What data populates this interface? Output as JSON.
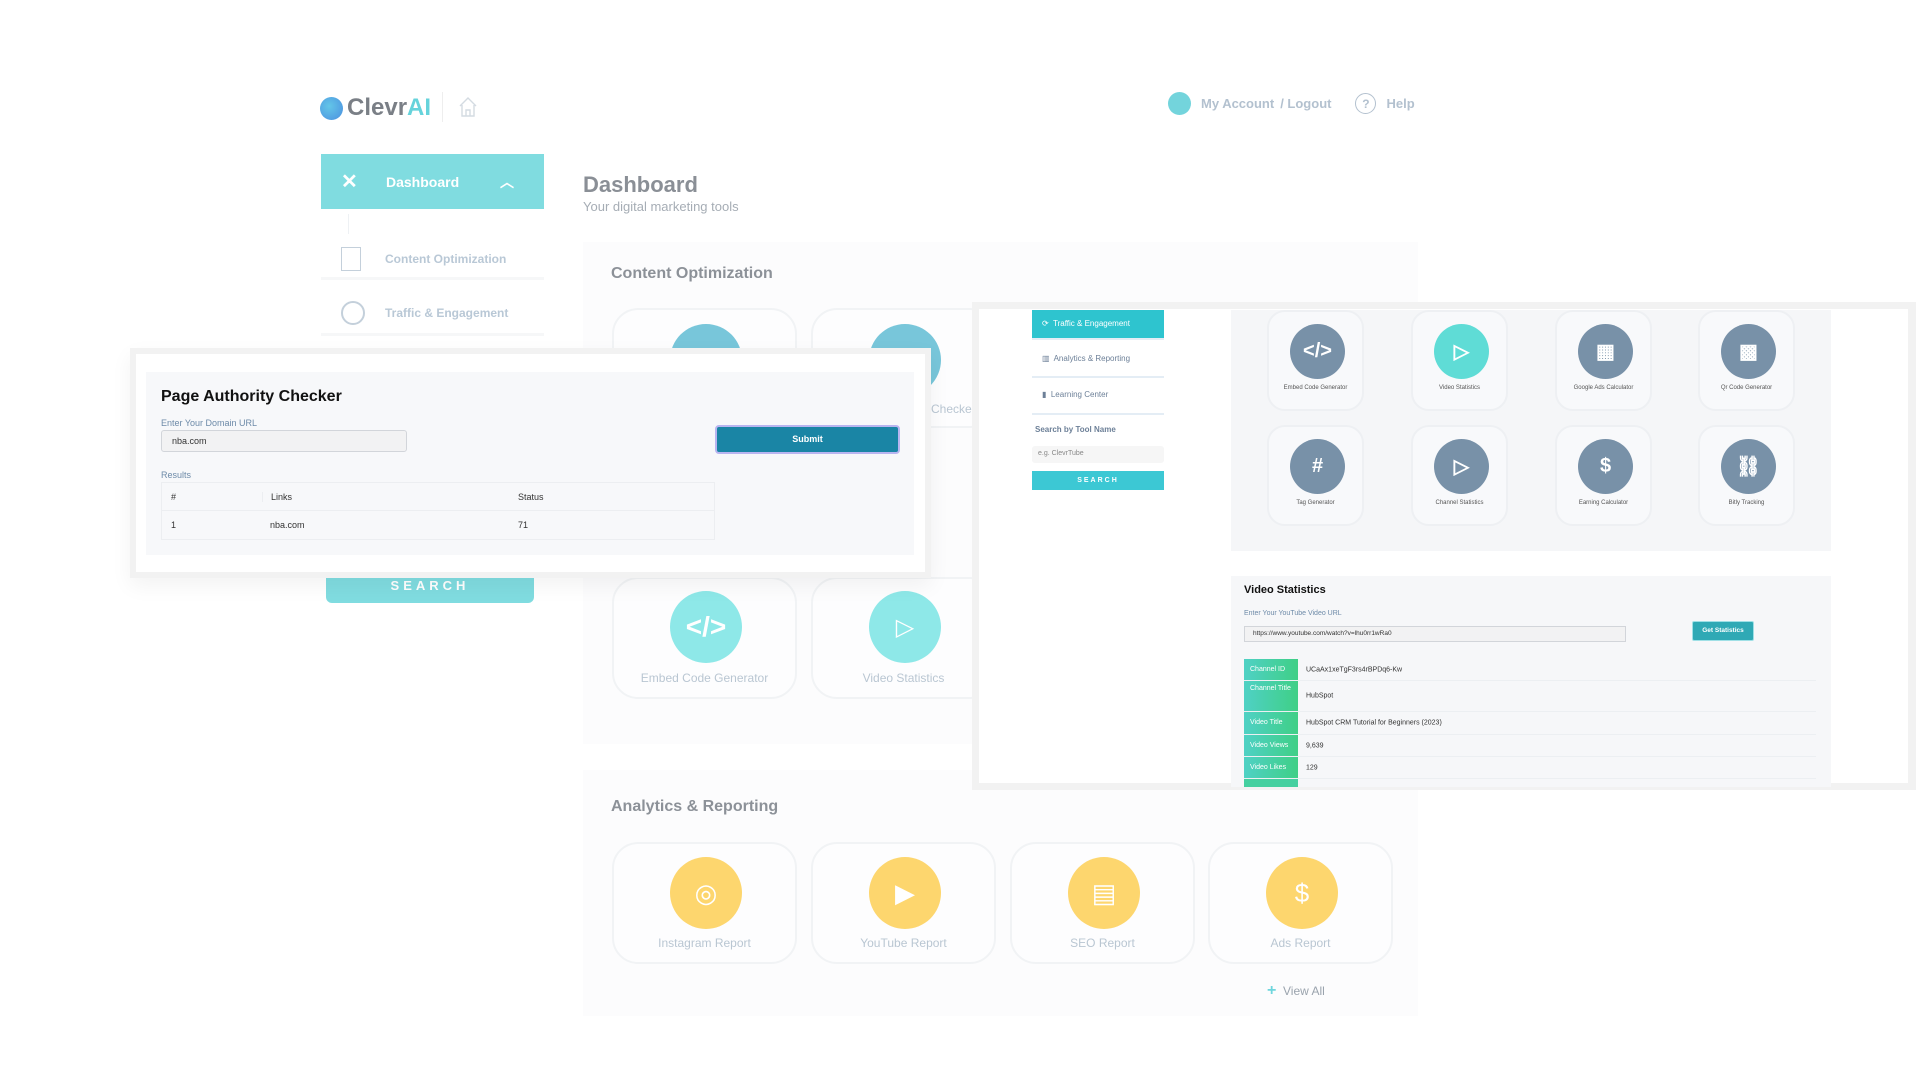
{
  "header": {
    "brand_a": "Clevr",
    "brand_b": "AI",
    "account": "My Account",
    "logout": "/ Logout",
    "help": "Help"
  },
  "sidebar": {
    "dashboard": "Dashboard",
    "items": [
      {
        "label": "Content Optimization"
      },
      {
        "label": "Traffic & Engagement"
      }
    ],
    "search_label": "SEARCH"
  },
  "page": {
    "title": "Dashboard",
    "subtitle": "Your digital marketing tools"
  },
  "content_optimization": {
    "heading": "Content Optimization",
    "partial_label": "Checke",
    "tools": [
      {
        "label": "Embed Code Generator",
        "icon": "code-icon"
      },
      {
        "label": "Video Statistics",
        "icon": "clapper-icon"
      }
    ]
  },
  "analytics": {
    "heading": "Analytics & Reporting",
    "tools": [
      {
        "label": "Instagram Report",
        "icon": "instagram-icon"
      },
      {
        "label": "YouTube Report",
        "icon": "youtube-icon"
      },
      {
        "label": "SEO Report",
        "icon": "seo-icon"
      },
      {
        "label": "Ads Report",
        "icon": "coins-icon"
      }
    ],
    "view_all": "View All"
  },
  "page_authority": {
    "title": "Page Authority Checker",
    "field_label": "Enter Your Domain URL",
    "field_value": "nba.com",
    "submit": "Submit",
    "results_label": "Results",
    "columns": [
      "#",
      "Links",
      "Status"
    ],
    "rows": [
      [
        "1",
        "nba.com",
        "71"
      ]
    ]
  },
  "traffic_panel": {
    "nav": [
      {
        "label": "Traffic & Engagement",
        "active": true
      },
      {
        "label": "Analytics & Reporting"
      },
      {
        "label": "Learning Center"
      }
    ],
    "search_heading": "Search by Tool Name",
    "search_placeholder": "e.g. ClevrTube",
    "search_button": "SEARCH",
    "tools": [
      "Embed Code Generator",
      "Video Statistics",
      "Google Ads Calculator",
      "Qr Code Generator",
      "Tag Generator",
      "Channel Statistics",
      "Earning Calculator",
      "Bitly Tracking"
    ]
  },
  "video_stats": {
    "title": "Video Statistics",
    "field_label": "Enter Your YouTube Video URL",
    "field_value": "https://www.youtube.com/watch?v=lhu0rr1wRa0",
    "button": "Get Statistics",
    "rows": [
      {
        "k": "Channel ID",
        "v": "UCaAx1xeTgF3rs4rBPDq6-Kw"
      },
      {
        "k": "Channel Title",
        "v": "HubSpot"
      },
      {
        "k": "Video Title",
        "v": "HubSpot CRM Tutorial for Beginners (2023)"
      },
      {
        "k": "Video Views",
        "v": "9,639"
      },
      {
        "k": "Video Likes",
        "v": "129"
      }
    ]
  },
  "colors": {
    "teal": "#80dce0",
    "teal_active": "#2ec4cf",
    "slate_icon": "#7891a8",
    "yellow": "#fdd66e",
    "submit": "#1a85a5"
  }
}
